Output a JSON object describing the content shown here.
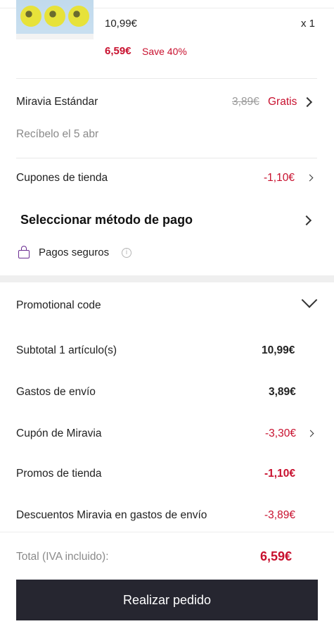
{
  "product": {
    "price": "10,99€",
    "quantity": "x 1",
    "sale_price": "6,59€",
    "save_label": "Save 40%"
  },
  "shipping": {
    "method": "Miravia Estándar",
    "old_price": "3,89€",
    "new_price": "Gratis",
    "delivery": "Recíbelo el 5 abr"
  },
  "coupons": {
    "label": "Cupones de tienda",
    "value": "-1,10€"
  },
  "payment": {
    "title": "Seleccionar método de pago",
    "secure_label": "Pagos seguros"
  },
  "promo": {
    "label": "Promotional code"
  },
  "summary": {
    "subtotal_label": "Subtotal 1 artículo(s)",
    "subtotal_value": "10,99€",
    "shipping_label": "Gastos de envío",
    "shipping_value": "3,89€",
    "coupon_label": "Cupón de Miravia",
    "coupon_value": "-3,30€",
    "store_promos_label": "Promos de tienda",
    "store_promos_value": "-1,10€",
    "shipping_discount_label": "Descuentos Miravia en gastos de envío",
    "shipping_discount_value": "-3,89€",
    "total_label": "Total (IVA incluido):",
    "total_value": "6,59€"
  },
  "actions": {
    "place_order": "Realizar pedido"
  },
  "colors": {
    "accent_red": "#c8102e",
    "button_dark": "#262630",
    "secure_purple": "#6a2c91"
  }
}
